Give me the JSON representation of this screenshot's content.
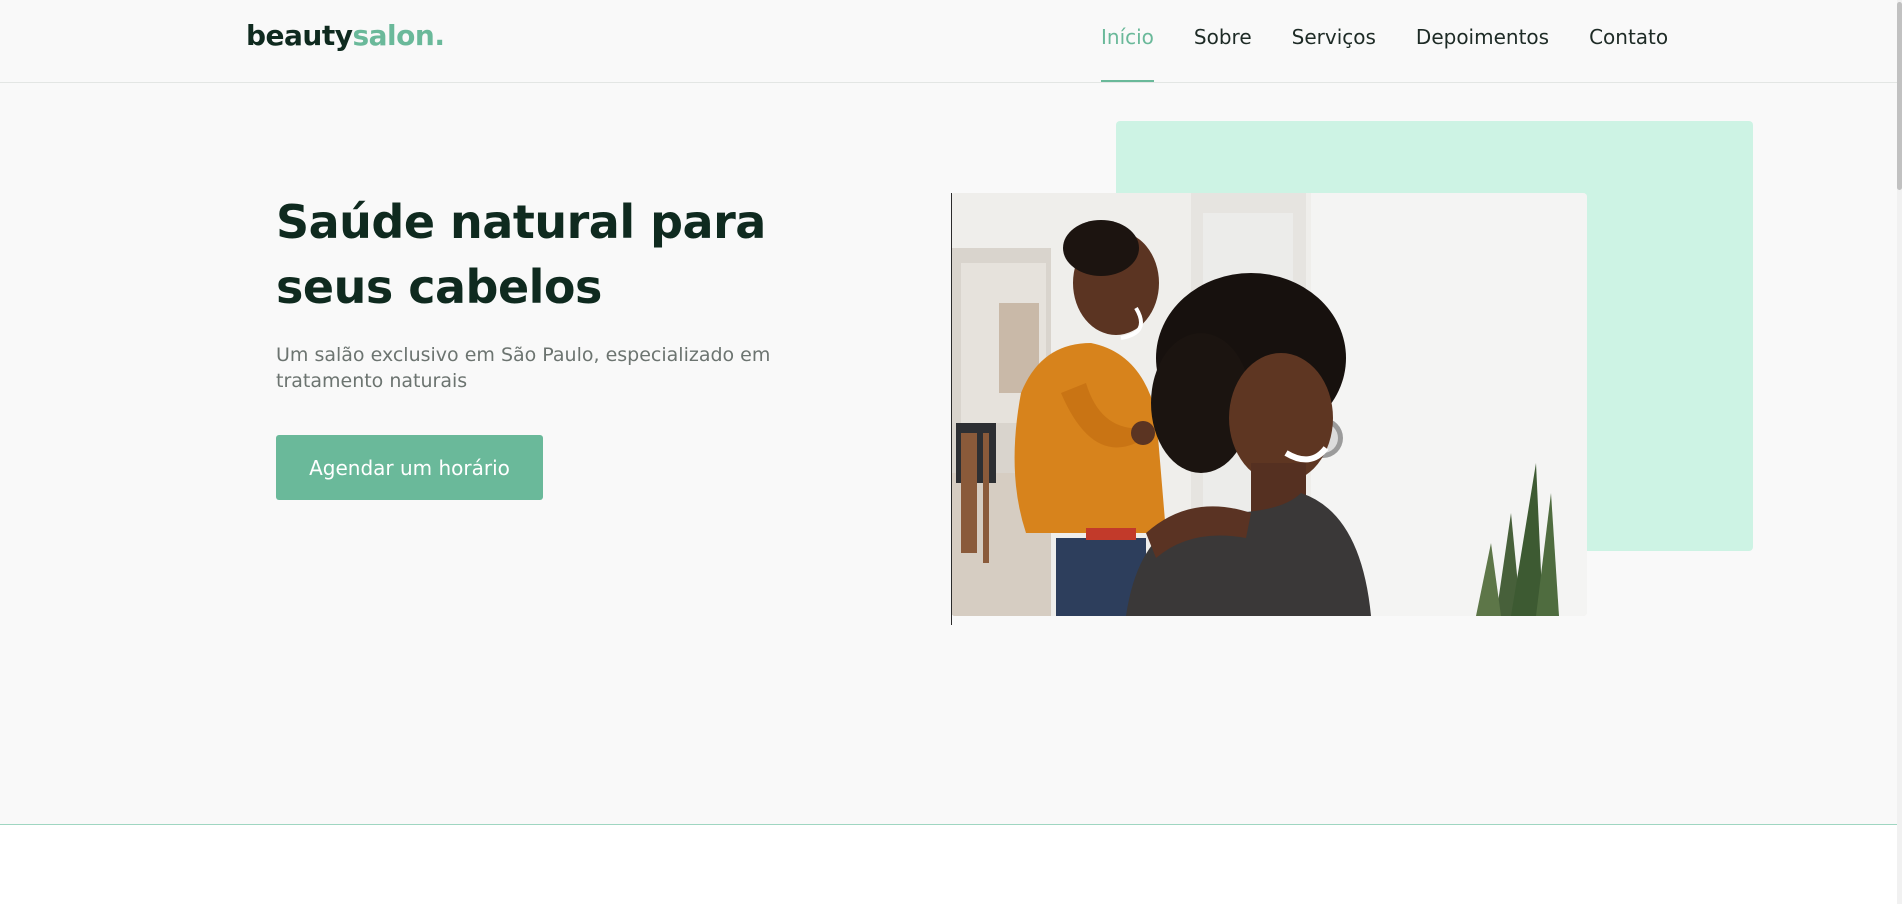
{
  "header": {
    "logo_main": "beauty",
    "logo_accent": "salon.",
    "nav": [
      {
        "label": "Início",
        "active": true
      },
      {
        "label": "Sobre",
        "active": false
      },
      {
        "label": "Serviços",
        "active": false
      },
      {
        "label": "Depoimentos",
        "active": false
      },
      {
        "label": "Contato",
        "active": false
      }
    ]
  },
  "hero": {
    "title": "Saúde natural para seus cabelos",
    "subtitle": "Um salão exclusivo em São Paulo, especializado em tratamento naturais",
    "cta_label": "Agendar um horário"
  },
  "colors": {
    "accent": "#6ab99a",
    "mint": "#cdf3e4",
    "dark": "#0f2a1f",
    "muted": "#6c7470",
    "background": "#f9f9f9"
  }
}
